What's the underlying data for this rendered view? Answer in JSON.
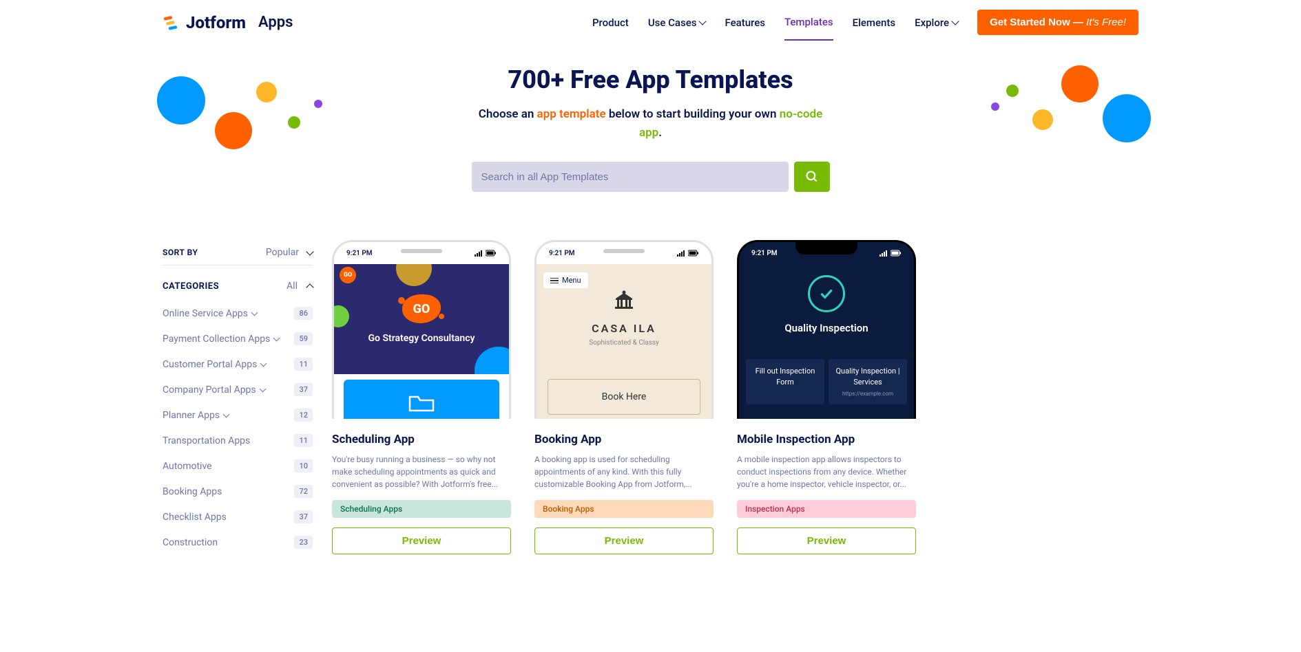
{
  "header": {
    "brand": "Jotform",
    "section": "Apps",
    "nav": [
      {
        "label": "Product",
        "dropdown": false
      },
      {
        "label": "Use Cases",
        "dropdown": true
      },
      {
        "label": "Features",
        "dropdown": false
      },
      {
        "label": "Templates",
        "dropdown": false,
        "active": true
      },
      {
        "label": "Elements",
        "dropdown": false
      },
      {
        "label": "Explore",
        "dropdown": true
      }
    ],
    "cta_main": "Get Started Now",
    "cta_sep": " — ",
    "cta_sub": "It's Free!"
  },
  "hero": {
    "title": "700+ Free App Templates",
    "sub_pre": "Choose an ",
    "sub_em1": "app template",
    "sub_mid": " below to start building your own ",
    "sub_em2": "no-code app",
    "sub_post": ".",
    "search_placeholder": "Search in all App Templates"
  },
  "sidebar": {
    "sort_label": "SORT BY",
    "sort_value": "Popular",
    "cat_title": "CATEGORIES",
    "cat_toggle": "All",
    "items": [
      {
        "name": "Online Service Apps",
        "count": "86",
        "expandable": true
      },
      {
        "name": "Payment Collection Apps",
        "count": "59",
        "expandable": true
      },
      {
        "name": "Customer Portal Apps",
        "count": "11",
        "expandable": true
      },
      {
        "name": "Company Portal Apps",
        "count": "37",
        "expandable": true
      },
      {
        "name": "Planner Apps",
        "count": "12",
        "expandable": true
      },
      {
        "name": "Transportation Apps",
        "count": "11",
        "expandable": false
      },
      {
        "name": "Automotive",
        "count": "10",
        "expandable": false
      },
      {
        "name": "Booking Apps",
        "count": "72",
        "expandable": false
      },
      {
        "name": "Checklist Apps",
        "count": "37",
        "expandable": false
      },
      {
        "name": "Construction",
        "count": "23",
        "expandable": false
      }
    ]
  },
  "phone_time": "9:21 PM",
  "mock1": {
    "go": "GO",
    "title": "Go Strategy Consultancy"
  },
  "mock2": {
    "menu": "Menu",
    "title": "CASA ILA",
    "sub": "Sophisticated & Classy",
    "btn": "Book Here"
  },
  "mock3": {
    "title": "Quality Inspection",
    "tile1": "Fill out Inspection Form",
    "tile2": "Quality Inspection | Services",
    "tile2sub": "https://example.com"
  },
  "cards": [
    {
      "title": "Scheduling App",
      "desc": "You're busy running a business — so why not make scheduling appointments as quick and convenient as possible? With Jotform's free...",
      "tag": "Scheduling Apps",
      "preview": "Preview"
    },
    {
      "title": "Booking App",
      "desc": "A booking app is used for scheduling appointments of any kind. With this fully customizable Booking App from Jotform,...",
      "tag": "Booking Apps",
      "preview": "Preview"
    },
    {
      "title": "Mobile Inspection App",
      "desc": "A mobile inspection app allows inspectors to conduct inspections from any device. Whether you're a home inspector, vehicle inspector, or...",
      "tag": "Inspection Apps",
      "preview": "Preview"
    }
  ]
}
